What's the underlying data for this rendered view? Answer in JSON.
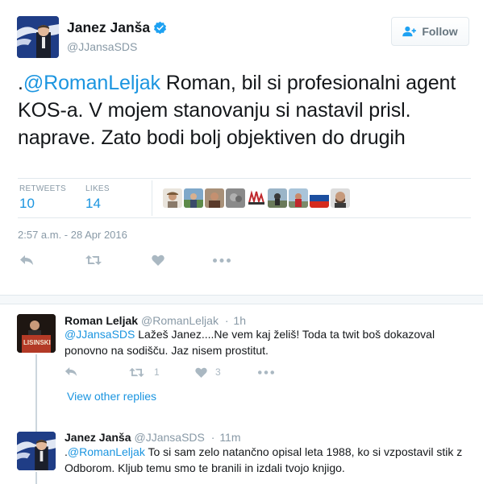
{
  "main_tweet": {
    "author_name": "Janez Janša",
    "author_handle": "@JJansaSDS",
    "follow_label": "Follow",
    "text_prefix": ".",
    "mention": "@RomanLeljak",
    "text_body": " Roman, bil si profesionalni agent KOS-a. V mojem stanovanju si nastavil prisl. naprave. Zato bodi bolj objektiven do drugih",
    "retweets_label": "RETWEETS",
    "retweets_count": "10",
    "likes_label": "LIKES",
    "likes_count": "14",
    "timestamp": "2:57 a.m. - 28 Apr 2016"
  },
  "replies": [
    {
      "author_name": "Roman Leljak",
      "author_handle": "@RomanLeljak",
      "separator": "·",
      "time": "1h",
      "mention": "@JJansaSDS",
      "text_body": " Lažeš Janez....Ne vem kaj želiš! Toda  ta twit boš dokazoval ponovno na sodišču. Jaz nisem prostitut.",
      "retweet_count": "1",
      "like_count": "3"
    },
    {
      "author_name": "Janez Janša",
      "author_handle": "@JJansaSDS",
      "separator": "·",
      "time": "11m",
      "text_prefix": ".",
      "mention": "@RomanLeljak",
      "text_body": " To si sam zelo natančno opisal leta 1988, ko si vzpostavil stik z Odborom. Kljub temu smo te branili in izdali tvojo knjigo."
    }
  ],
  "view_other_replies": "View other replies",
  "avatar_sign_text": "LISINSKI",
  "colors": {
    "link": "#1b95e0",
    "verified": "#1da1f2",
    "icon": "#aab8c2",
    "muted": "#8899a6"
  }
}
